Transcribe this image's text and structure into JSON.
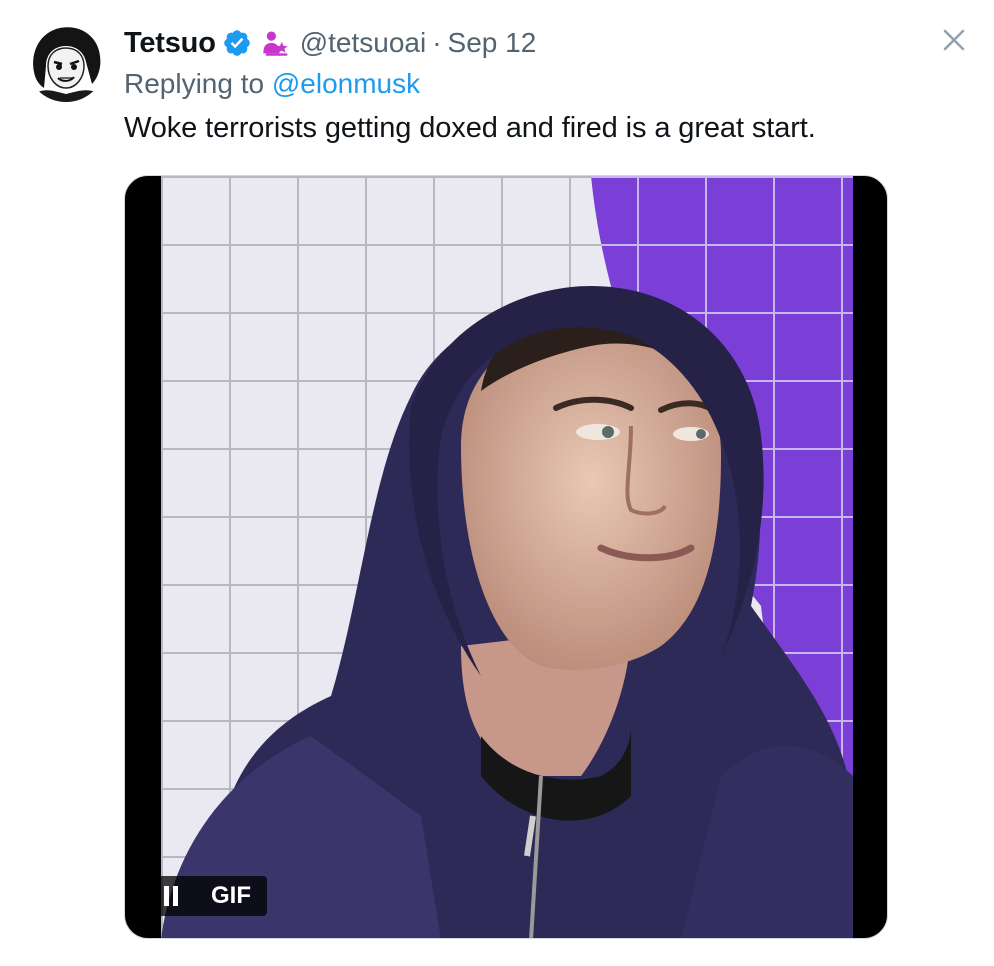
{
  "tweet": {
    "author": {
      "display_name": "Tetsuo",
      "handle": "@tetsuoai",
      "verified_icon": "verified-badge-icon",
      "affiliation_icon": "person-star-icon",
      "avatar_icon": "anime-avatar"
    },
    "separator": "·",
    "date": "Sep 12",
    "reply_prefix": "Replying to",
    "reply_to": "@elonmusk",
    "text": "Woke terrorists getting doxed and fired is a great start.",
    "media": {
      "type": "gif",
      "badge": "GIF",
      "pause_icon": "pause-icon"
    }
  },
  "close_icon": "close-icon",
  "colors": {
    "link": "#1d9bf0",
    "muted": "#536471",
    "text": "#0f1419",
    "verified": "#1d9bf0",
    "affiliation": "#c936ce"
  }
}
